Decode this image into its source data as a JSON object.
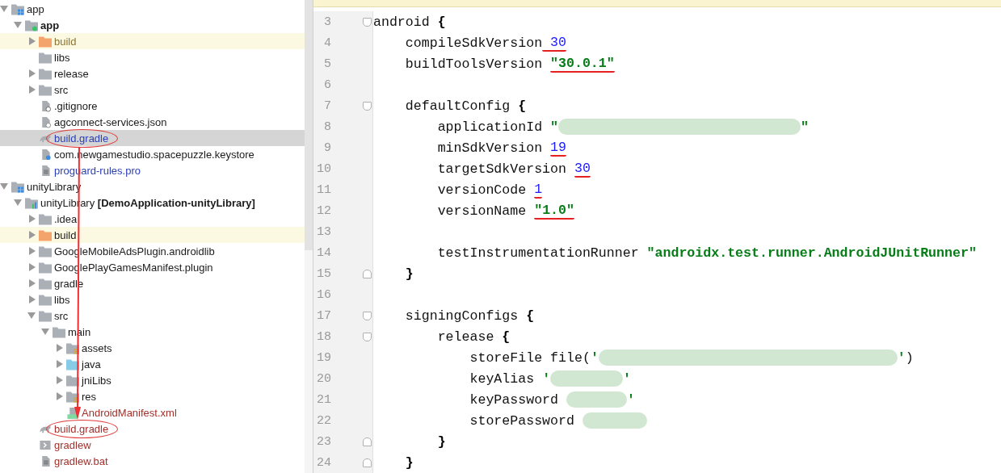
{
  "project_tree": [
    {
      "label": "app",
      "kind": "module",
      "expanded": true,
      "selected": false,
      "children": [
        {
          "label": "app",
          "kind": "app-module",
          "bold": true,
          "expanded": true,
          "selected": false,
          "children": [
            {
              "label": "build",
              "kind": "excluded-folder",
              "color": "#8a7430",
              "expanded": false,
              "selected": false
            },
            {
              "label": "libs",
              "kind": "folder",
              "selected": false
            },
            {
              "label": "release",
              "kind": "folder",
              "expanded": false,
              "selected": false
            },
            {
              "label": "src",
              "kind": "folder",
              "expanded": false,
              "selected": false
            },
            {
              "label": ".gitignore",
              "kind": "ignore-file",
              "selected": false
            },
            {
              "label": "agconnect-services.json",
              "kind": "json-file",
              "selected": false
            },
            {
              "label": "build.gradle",
              "kind": "gradle-file",
              "color": "#2a3fb5",
              "circled": true,
              "selected": true
            },
            {
              "label": "com.newgamestudio.spacepuzzle.keystore",
              "kind": "unknown-file",
              "selected": false
            },
            {
              "label": "proguard-rules.pro",
              "kind": "text-file",
              "color": "#2a3fb5",
              "selected": false
            }
          ]
        }
      ]
    },
    {
      "label": "unityLibrary",
      "kind": "module",
      "expanded": true,
      "selected": false,
      "children": [
        {
          "label": "unityLibrary **[DemoApplication-unityLibrary]**",
          "kind": "library-module",
          "expanded": true,
          "selected": false,
          "children": [
            {
              "label": ".idea",
              "kind": "folder",
              "expanded": false,
              "selected": false
            },
            {
              "label": "build",
              "kind": "excluded-folder",
              "expanded": false,
              "selected": false
            },
            {
              "label": "GoogleMobileAdsPlugin.androidlib",
              "kind": "folder",
              "expanded": false,
              "selected": false
            },
            {
              "label": "GooglePlayGamesManifest.plugin",
              "kind": "folder",
              "expanded": false,
              "selected": false
            },
            {
              "label": "gradle",
              "kind": "folder",
              "expanded": false,
              "selected": false
            },
            {
              "label": "libs",
              "kind": "folder",
              "expanded": false,
              "selected": false
            },
            {
              "label": "src",
              "kind": "folder",
              "expanded": true,
              "selected": false,
              "children": [
                {
                  "label": "main",
                  "kind": "folder",
                  "expanded": true,
                  "selected": false,
                  "children": [
                    {
                      "label": "assets",
                      "kind": "resource-folder",
                      "expanded": false,
                      "selected": false
                    },
                    {
                      "label": "java",
                      "kind": "source-folder",
                      "expanded": false,
                      "selected": false
                    },
                    {
                      "label": "jniLibs",
                      "kind": "folder",
                      "expanded": false,
                      "selected": false
                    },
                    {
                      "label": "res",
                      "kind": "resource-folder",
                      "expanded": false,
                      "selected": false
                    },
                    {
                      "label": "AndroidManifest.xml",
                      "kind": "manifest-file",
                      "color": "#a3312b",
                      "selected": false
                    }
                  ]
                }
              ]
            },
            {
              "label": "build.gradle",
              "kind": "gradle-file",
              "color": "#a3312b",
              "circled": true,
              "selected": false
            },
            {
              "label": "gradlew",
              "kind": "script-file",
              "color": "#a3312b",
              "selected": false
            },
            {
              "label": "gradlew.bat",
              "kind": "text-file",
              "color": "#a3312b",
              "selected": false
            }
          ]
        }
      ]
    }
  ],
  "editor": {
    "lines": [
      {
        "number": "3",
        "fold_start": true,
        "tokens": [
          {
            "text": "android ",
            "kind": "plain"
          },
          {
            "text": "{",
            "kind": "brace"
          }
        ]
      },
      {
        "number": "4",
        "tokens": [
          {
            "text": "    compileSdkVersion",
            "kind": "plain"
          },
          {
            "text": " 30",
            "kind": "number",
            "underlined": true
          }
        ]
      },
      {
        "number": "5",
        "tokens": [
          {
            "text": "    buildToolsVersion ",
            "kind": "plain"
          },
          {
            "text": "\"30.0.1\"",
            "kind": "string",
            "underlined": true
          }
        ]
      },
      {
        "number": "6"
      },
      {
        "number": "7",
        "fold_start": true,
        "tokens": [
          {
            "text": "    defaultConfig ",
            "kind": "plain"
          },
          {
            "text": "{",
            "kind": "brace"
          }
        ]
      },
      {
        "number": "8",
        "tokens": [
          {
            "text": "        applicationId ",
            "kind": "plain"
          },
          {
            "text": "\"",
            "kind": "string"
          },
          {
            "kind": "redacted"
          },
          {
            "text": "\"",
            "kind": "string"
          }
        ]
      },
      {
        "number": "9",
        "tokens": [
          {
            "text": "        minSdkVersion ",
            "kind": "plain"
          },
          {
            "text": "19",
            "kind": "number",
            "underlined": true
          }
        ]
      },
      {
        "number": "10",
        "tokens": [
          {
            "text": "        targetSdkVersion ",
            "kind": "plain"
          },
          {
            "text": "30",
            "kind": "number",
            "underlined": true
          }
        ]
      },
      {
        "number": "11",
        "tokens": [
          {
            "text": "        versionCode ",
            "kind": "plain"
          },
          {
            "text": "1",
            "kind": "number",
            "underlined": true
          }
        ]
      },
      {
        "number": "12",
        "tokens": [
          {
            "text": "        versionName ",
            "kind": "plain"
          },
          {
            "text": "\"1.0\"",
            "kind": "string",
            "underlined": true
          }
        ]
      },
      {
        "number": "13"
      },
      {
        "number": "14",
        "tokens": [
          {
            "text": "        testInstrumentationRunner ",
            "kind": "plain"
          },
          {
            "text": "\"androidx.test.runner.AndroidJUnitRunner\"",
            "kind": "string"
          }
        ]
      },
      {
        "number": "15",
        "fold_end": true,
        "tokens": [
          {
            "text": "    }",
            "kind": "brace"
          }
        ]
      },
      {
        "number": "16"
      },
      {
        "number": "17",
        "fold_start": true,
        "tokens": [
          {
            "text": "    signingConfigs ",
            "kind": "plain"
          },
          {
            "text": "{",
            "kind": "brace"
          }
        ]
      },
      {
        "number": "18",
        "fold_start": true,
        "tokens": [
          {
            "text": "        release ",
            "kind": "plain"
          },
          {
            "text": "{",
            "kind": "brace"
          }
        ]
      },
      {
        "number": "19",
        "tokens": [
          {
            "text": "            storeFile file(",
            "kind": "plain"
          },
          {
            "text": "'",
            "kind": "string"
          },
          {
            "kind": "redacted"
          },
          {
            "text": "'",
            "kind": "string"
          },
          {
            "text": ")",
            "kind": "plain"
          }
        ]
      },
      {
        "number": "20",
        "tokens": [
          {
            "text": "            keyAlias ",
            "kind": "plain"
          },
          {
            "text": "'",
            "kind": "string"
          },
          {
            "kind": "redacted"
          },
          {
            "text": "'",
            "kind": "string"
          }
        ]
      },
      {
        "number": "21",
        "tokens": [
          {
            "text": "            keyPassword ",
            "kind": "plain"
          },
          {
            "kind": "redacted"
          },
          {
            "text": "'",
            "kind": "string"
          }
        ]
      },
      {
        "number": "22",
        "tokens": [
          {
            "text": "            storePassword ",
            "kind": "plain"
          },
          {
            "kind": "redacted"
          }
        ]
      },
      {
        "number": "23",
        "fold_end": true,
        "tokens": [
          {
            "text": "        }",
            "kind": "brace"
          }
        ]
      },
      {
        "number": "24",
        "fold_end": true,
        "tokens": [
          {
            "text": "    }",
            "kind": "brace"
          }
        ]
      }
    ]
  }
}
